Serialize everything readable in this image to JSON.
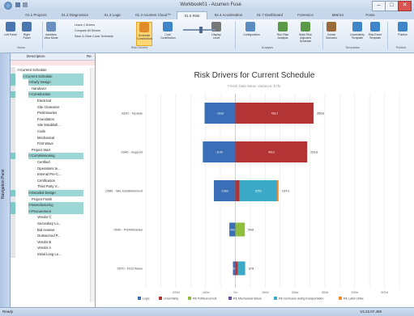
{
  "window": {
    "title": "Workbook01 - Acumen Fuse",
    "btn_min": "–",
    "btn_max": "□",
    "btn_close": "✕"
  },
  "tabs": [
    "01.1 Projects",
    "01.2 Diagnostics",
    "01.3 Logic",
    "01.4 Acumen Cloud™",
    "01.5 Risk",
    "04.4 Acceleration",
    "01.7 Dashboard",
    "Forensics",
    "Metrics",
    "Fonts"
  ],
  "active_tab": 4,
  "ribbon": {
    "buttons": [
      {
        "label": "Left Panel"
      },
      {
        "label": "Right Panel"
      },
      {
        "label": "Activities View Mode"
      },
      {
        "label": "Schedule Contribution"
      },
      {
        "label": "Cost Contribution"
      },
      {
        "label": "Display Level"
      },
      {
        "label": "Configuration"
      },
      {
        "label": "Run Risk Analysis"
      },
      {
        "label": "Build Risk Adjusted Schedule"
      },
      {
        "label": "Create Scenario"
      },
      {
        "label": "Uncertainty Template"
      },
      {
        "label": "Risk Event Template"
      },
      {
        "label": "Publish"
      }
    ],
    "options": [
      "Leave // Drivers",
      "Compare All Drivers",
      "Save & Clear Cover Schedule"
    ],
    "groups": [
      "Views",
      "Risk Drivers",
      "Analysis",
      "Templates",
      "Publish"
    ]
  },
  "navpane": {
    "label": "Navigation Pane"
  },
  "tree": {
    "col_description": "Description",
    "col_flag": "Re",
    "rows": [
      {
        "label": "Current Schedule",
        "indent": 0,
        "exp": "⊟",
        "hl": false
      },
      {
        "label": "Current Schedule",
        "indent": 1,
        "exp": "⊟",
        "hl": true
      },
      {
        "label": "Early Design",
        "indent": 2,
        "exp": "⊞",
        "hl": true
      },
      {
        "label": "Handover",
        "indent": 2,
        "exp": "",
        "hl": false
      },
      {
        "label": "Construction",
        "indent": 2,
        "exp": "⊟",
        "hl": true
      },
      {
        "label": "Electrical",
        "indent": 3,
        "exp": "",
        "hl": false
      },
      {
        "label": "Site Clearance",
        "indent": 3,
        "exp": "",
        "hl": false
      },
      {
        "label": "Preliminaries",
        "indent": 3,
        "exp": "",
        "hl": false
      },
      {
        "label": "Foundation",
        "indent": 3,
        "exp": "",
        "hl": false
      },
      {
        "label": "Site Establish...",
        "indent": 3,
        "exp": "",
        "hl": false
      },
      {
        "label": "Civils",
        "indent": 3,
        "exp": "",
        "hl": false
      },
      {
        "label": "Mechanical",
        "indent": 3,
        "exp": "",
        "hl": false
      },
      {
        "label": "First Wave",
        "indent": 3,
        "exp": "",
        "hl": false
      },
      {
        "label": "Project Start",
        "indent": 2,
        "exp": "",
        "hl": false
      },
      {
        "label": "Commissioning",
        "indent": 2,
        "exp": "⊟",
        "hl": true
      },
      {
        "label": "Certified",
        "indent": 3,
        "exp": "",
        "hl": false
      },
      {
        "label": "Operations te...",
        "indent": 3,
        "exp": "",
        "hl": false
      },
      {
        "label": "Internal Pre-C...",
        "indent": 3,
        "exp": "",
        "hl": false
      },
      {
        "label": "Certification",
        "indent": 3,
        "exp": "",
        "hl": false
      },
      {
        "label": "Third Party V...",
        "indent": 3,
        "exp": "",
        "hl": false
      },
      {
        "label": "Detailed Design",
        "indent": 2,
        "exp": "⊞",
        "hl": true
      },
      {
        "label": "Project Finish",
        "indent": 2,
        "exp": "",
        "hl": false
      },
      {
        "label": "Manufacturing",
        "indent": 2,
        "exp": "⊞",
        "hl": true
      },
      {
        "label": "Procurement",
        "indent": 2,
        "exp": "⊟",
        "hl": true
      },
      {
        "label": "Vendor C",
        "indent": 3,
        "exp": "",
        "hl": false
      },
      {
        "label": "Secondary Lo...",
        "indent": 3,
        "exp": "",
        "hl": false
      },
      {
        "label": "Bid reviews",
        "indent": 3,
        "exp": "",
        "hl": false
      },
      {
        "label": "Outsourced P...",
        "indent": 3,
        "exp": "",
        "hl": false
      },
      {
        "label": "Vendor B",
        "indent": 3,
        "exp": "",
        "hl": false
      },
      {
        "label": "Vendor A",
        "indent": 3,
        "exp": "",
        "hl": false
      },
      {
        "label": "Initial Long Le...",
        "indent": 3,
        "exp": "",
        "hl": false
      }
    ]
  },
  "chart_data": {
    "type": "bar",
    "orientation": "horizontal-stacked-diverging",
    "title": "Risk Drivers for Current Schedule",
    "subtitle": "Finish Date Mean Variance: 57hr",
    "categories": [
      "0330 - Topside",
      "0340 - Support",
      "0580 - Site Establishment",
      "0600 - Preliminaries",
      "0570 - First Wave"
    ],
    "totals": [
      "265d",
      "251d",
      "137d",
      "54d",
      "37d"
    ],
    "xlim": [
      -300,
      550
    ],
    "xticks": [
      -300,
      -250,
      -200,
      -150,
      -100,
      -50,
      0,
      50,
      100,
      150,
      200,
      250,
      300,
      350,
      400,
      450,
      500,
      550
    ],
    "xtick_labels": [
      "",
      "",
      "-200d",
      "",
      "-100d",
      "",
      "0d",
      "",
      "100d",
      "",
      "200d",
      "",
      "300d",
      "",
      "400d",
      "",
      "500d",
      ""
    ],
    "series": [
      {
        "name": "Logic",
        "color": "#3a6fb8",
        "values": [
          -103,
          -109,
          -72,
          -20,
          -8
        ],
        "labels": [
          "-103d",
          "-114d",
          "-100d",
          "40d",
          "8d"
        ]
      },
      {
        "name": "Uncertainty",
        "color": "#b23434",
        "values": [
          262,
          241,
          14,
          0,
          9
        ],
        "labels": [
          "461d",
          "451d",
          "",
          "",
          ""
        ]
      },
      {
        "name": "RE Political unrest",
        "color": "#8fbe3f",
        "values": [
          0,
          0,
          0,
          32,
          0
        ],
        "labels": [
          "",
          "",
          "",
          "",
          ""
        ]
      },
      {
        "name": "RE Mechanical failure",
        "color": "#6b4ea0",
        "values": [
          0,
          0,
          0,
          0,
          0
        ],
        "labels": [
          "",
          "",
          "",
          "",
          ""
        ]
      },
      {
        "name": "RE Hurricane during transportation",
        "color": "#3aaac8",
        "values": [
          0,
          0,
          126,
          0,
          24
        ],
        "labels": [
          "",
          "",
          "325d",
          "",
          ""
        ]
      },
      {
        "name": "RE Labor strike",
        "color": "#f08a2c",
        "values": [
          0,
          0,
          5,
          0,
          0
        ],
        "labels": [
          "",
          "",
          "",
          "",
          ""
        ]
      }
    ],
    "legend_position": "bottom",
    "grid": true
  },
  "status": {
    "left": "Ready",
    "right": "V3.23.07.459"
  }
}
